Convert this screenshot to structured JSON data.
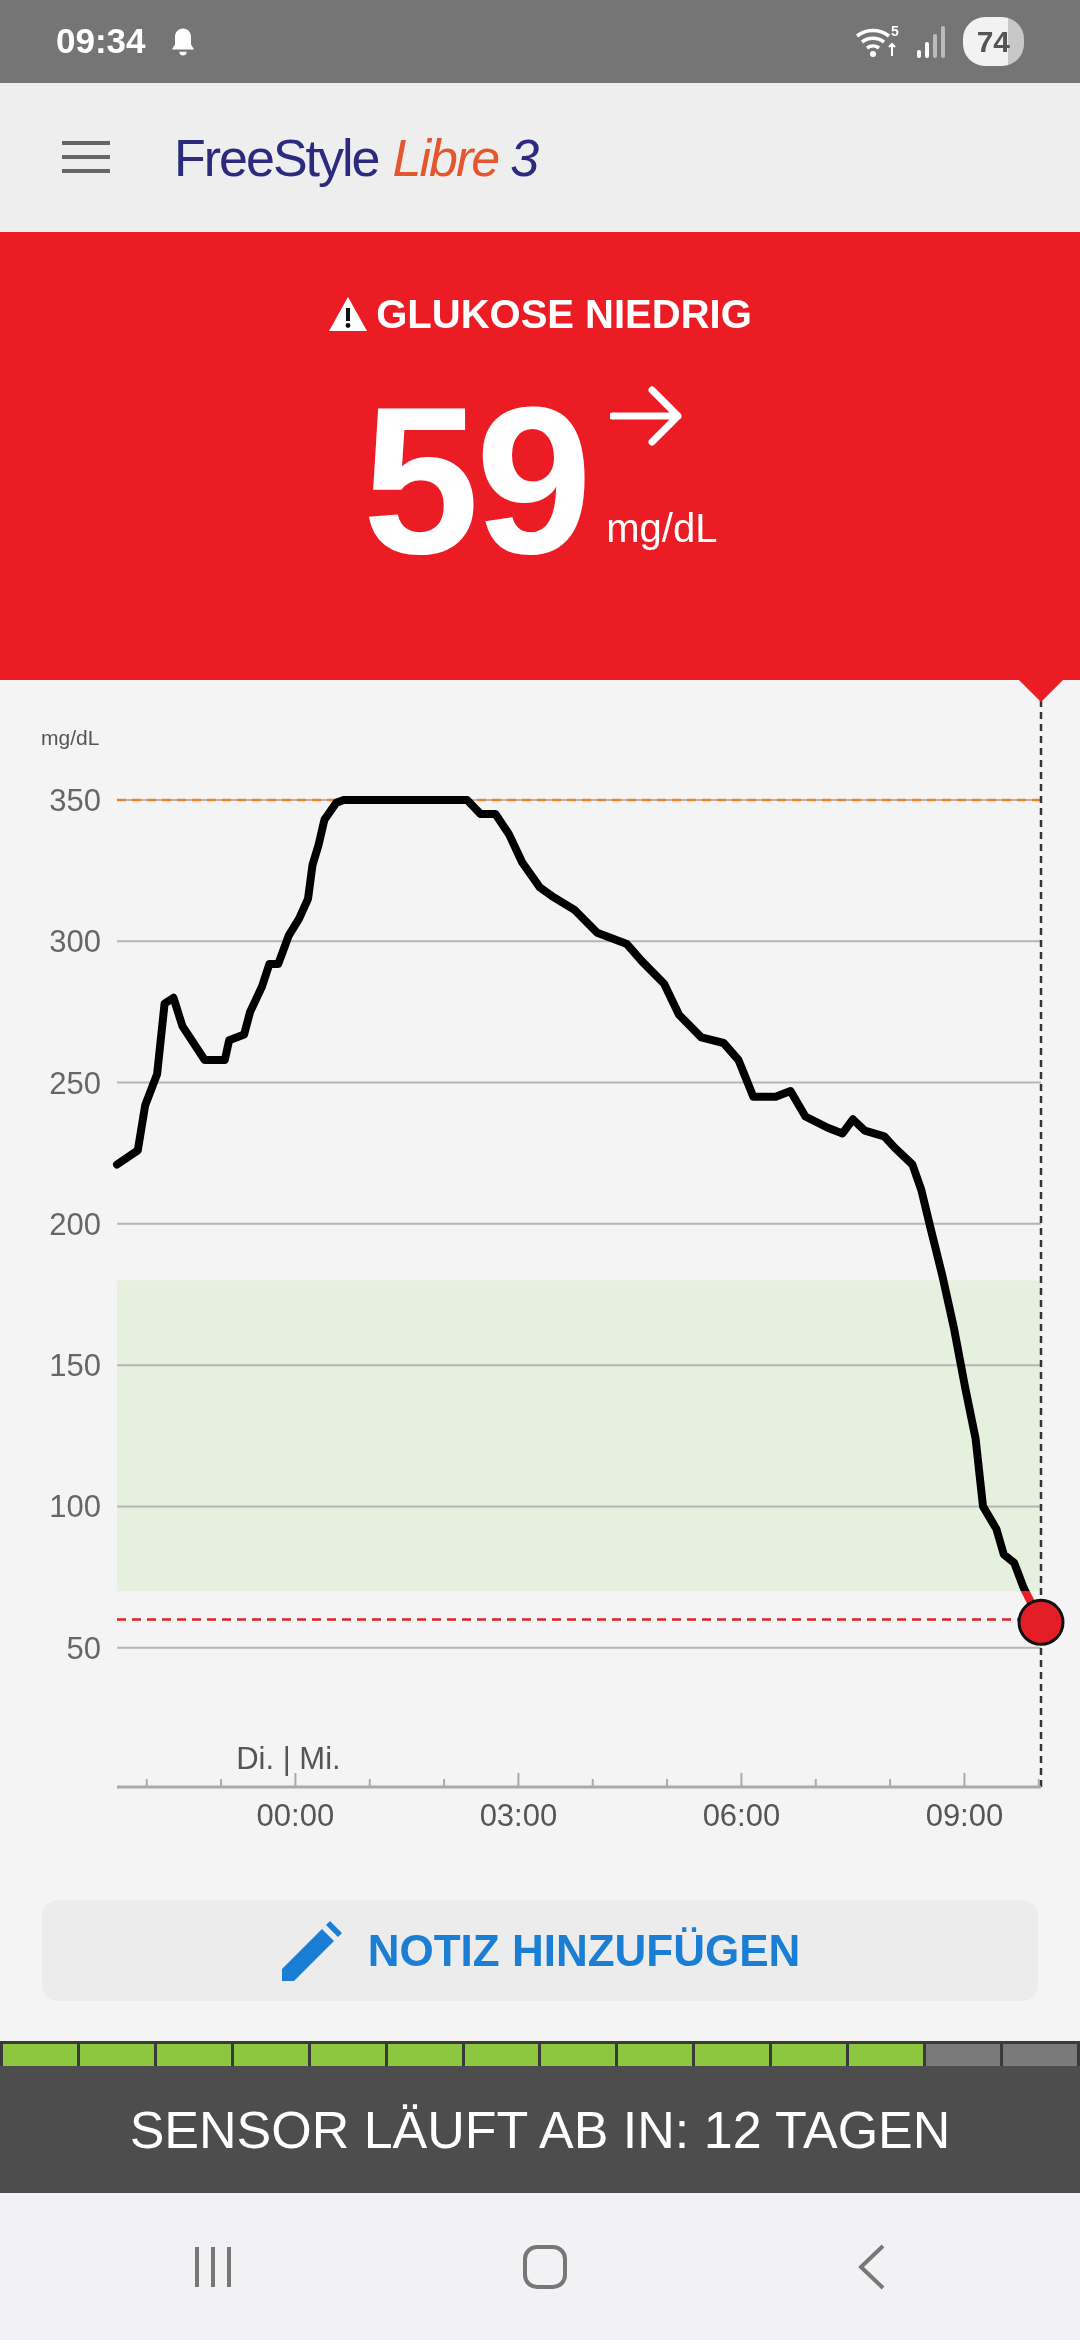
{
  "status_bar": {
    "time": "09:34",
    "wifi_label": "5",
    "battery": "74"
  },
  "header": {
    "brand": "FreeStyle",
    "product": "Libre",
    "version": "3"
  },
  "alert": {
    "kind": "low",
    "title": "GLUKOSE NIEDRIG",
    "value": "59",
    "unit": "mg/dL"
  },
  "chart": {
    "chart_data": {
      "type": "line",
      "ylabel": "mg/dL",
      "x": [
        -2.4,
        -2.12,
        -2.02,
        -1.86,
        -1.76,
        -1.64,
        -1.52,
        -1.22,
        -0.95,
        -0.89,
        -0.69,
        -0.61,
        -0.45,
        -0.35,
        -0.23,
        -0.09,
        0.05,
        0.17,
        0.23,
        0.31,
        0.39,
        0.55,
        0.65,
        2.31,
        2.49,
        2.69,
        2.87,
        3.05,
        3.29,
        3.45,
        3.76,
        4.06,
        4.46,
        4.66,
        4.96,
        5.16,
        5.46,
        5.76,
        5.96,
        6.16,
        6.46,
        6.66,
        6.86,
        7.16,
        7.36,
        7.5,
        7.66,
        7.92,
        8.06,
        8.3,
        8.42,
        8.54,
        8.7,
        8.86,
        9.01,
        9.15,
        9.25,
        9.43,
        9.53,
        9.67,
        9.8,
        10.03
      ],
      "series": [
        {
          "color": "#000000",
          "values": [
            221,
            226,
            242,
            253,
            278,
            280,
            270,
            258,
            258,
            265,
            267,
            275,
            284,
            292,
            292,
            302,
            308,
            315,
            327,
            334,
            343,
            349,
            350,
            350,
            345,
            345,
            338,
            328,
            319,
            316,
            311,
            303,
            299,
            293,
            285,
            274,
            266,
            264,
            258,
            245,
            245,
            247,
            238,
            234,
            232,
            237,
            233,
            231,
            227,
            221,
            212,
            199,
            182,
            163,
            142,
            124,
            100,
            92,
            83,
            80,
            71,
            59
          ]
        }
      ],
      "xlim": [
        -2.4,
        10.03
      ],
      "ylim": [
        0,
        350
      ],
      "grid": true,
      "xticks": [
        {
          "value": 0,
          "label": "00:00"
        },
        {
          "value": 3,
          "label": "03:00"
        },
        {
          "value": 6,
          "label": "06:00"
        },
        {
          "value": 9,
          "label": "09:00"
        }
      ],
      "yticks": [
        50,
        100,
        150,
        200,
        250,
        300,
        350
      ],
      "bands": [
        {
          "axis": "y",
          "from": 70,
          "to": 180,
          "color": "#e6f0df"
        }
      ],
      "ref_lines": [
        {
          "axis": "y",
          "value": 350,
          "color": "#e8832a"
        },
        {
          "axis": "y",
          "value": 60,
          "color": "#e31e26"
        },
        {
          "axis": "x",
          "value": 10.03,
          "color": "#333333"
        }
      ]
    },
    "day_label": "Di. | Mi."
  },
  "note_button": {
    "label": "NOTIZ HINZUFÜGEN"
  },
  "sensor": {
    "segments": [
      {
        "active": true
      },
      {
        "active": true
      },
      {
        "active": true
      },
      {
        "active": true
      },
      {
        "active": true
      },
      {
        "active": true
      },
      {
        "active": true
      },
      {
        "active": true
      },
      {
        "active": true
      },
      {
        "active": true
      },
      {
        "active": true
      },
      {
        "active": true
      },
      {
        "active": false
      },
      {
        "active": false
      }
    ],
    "message": "SENSOR LÄUFT AB IN: 12 TAGEN"
  }
}
